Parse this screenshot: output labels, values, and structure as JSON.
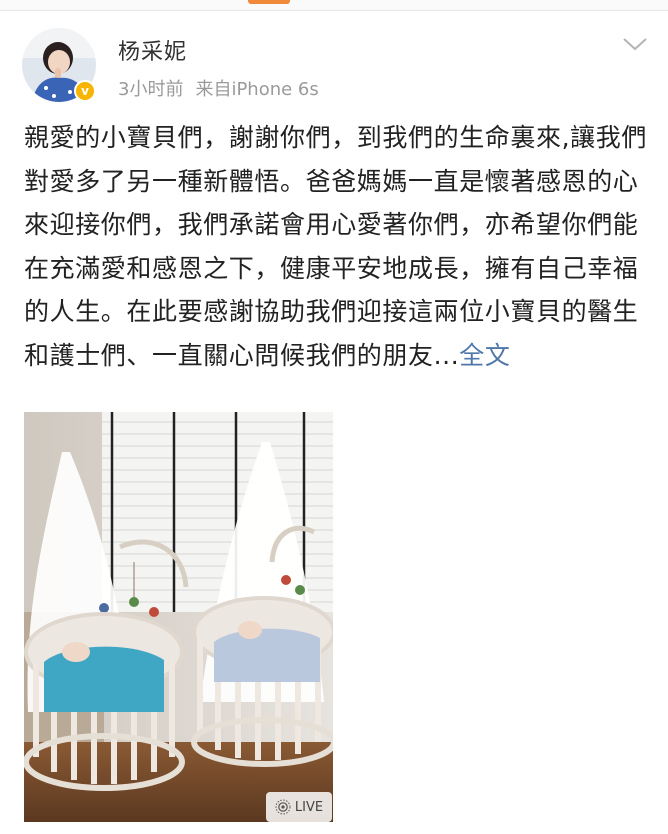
{
  "post": {
    "author": "杨采妮",
    "time": "3小时前",
    "source": "来自iPhone 6s",
    "text": "親愛的小寶貝們，謝謝你們，到我們的生命裏來,讓我們對愛多了另一種新體悟。爸爸媽媽一直是懷著感恩的心來迎接你們，我們承諾會用心愛著你們，亦希望你們能在充滿愛和感恩之下，健康平安地成長，擁有自己幸福的人生。在此要感謝協助我們迎接這兩位小寶貝的醫生和護士們、一直關心問候我們的朋友...",
    "more_label": "全文",
    "live_label": "LIVE"
  },
  "icons": {
    "verified": "verified-badge-icon",
    "menu": "chevron-down-icon",
    "live": "live-photo-icon"
  },
  "colors": {
    "link": "#5077aa",
    "badge": "#f7b500",
    "text": "#222222",
    "meta": "#9a9a9a"
  }
}
